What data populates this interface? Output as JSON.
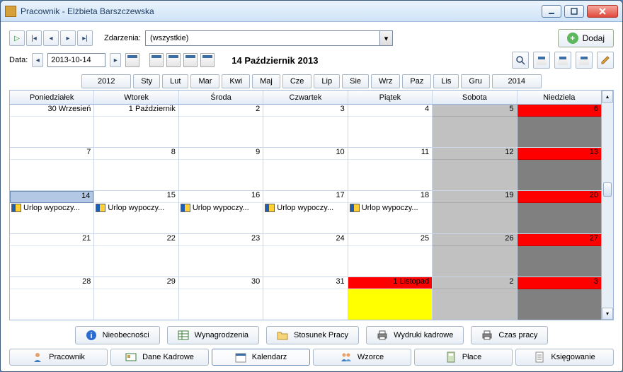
{
  "window": {
    "title": "Pracownik - Elżbieta Barszczewska"
  },
  "toolbar1": {
    "events_label": "Zdarzenia:",
    "events_value": "(wszystkie)",
    "add_label": "Dodaj"
  },
  "toolbar2": {
    "date_label": "Data:",
    "date_value": "2013-10-14",
    "heading": "14 Październik 2013"
  },
  "monthnav": {
    "prev_year": "2012",
    "next_year": "2014",
    "months": [
      "Sty",
      "Lut",
      "Mar",
      "Kwi",
      "Maj",
      "Cze",
      "Lip",
      "Sie",
      "Wrz",
      "Paz",
      "Lis",
      "Gru"
    ]
  },
  "day_headers": [
    "Poniedziałek",
    "Wtorek",
    "Środa",
    "Czwartek",
    "Piątek",
    "Sobota",
    "Niedziela"
  ],
  "event_text": "Urlop wypoczy...",
  "weeks": [
    [
      {
        "label": "30 Wrzesień"
      },
      {
        "label": "1 Październik"
      },
      {
        "label": "2"
      },
      {
        "label": "3"
      },
      {
        "label": "4"
      },
      {
        "label": "5",
        "sat": true
      },
      {
        "label": "6",
        "sun": true
      }
    ],
    [
      {
        "label": "7"
      },
      {
        "label": "8"
      },
      {
        "label": "9"
      },
      {
        "label": "10"
      },
      {
        "label": "11"
      },
      {
        "label": "12",
        "sat": true
      },
      {
        "label": "13",
        "sun": true
      }
    ],
    [
      {
        "label": "14",
        "selected": true,
        "event": true
      },
      {
        "label": "15",
        "event": true
      },
      {
        "label": "16",
        "event": true
      },
      {
        "label": "17",
        "event": true
      },
      {
        "label": "18",
        "event": true
      },
      {
        "label": "19",
        "sat": true
      },
      {
        "label": "20",
        "sun": true
      }
    ],
    [
      {
        "label": "21"
      },
      {
        "label": "22"
      },
      {
        "label": "23"
      },
      {
        "label": "24"
      },
      {
        "label": "25"
      },
      {
        "label": "26",
        "sat": true
      },
      {
        "label": "27",
        "sun": true
      }
    ],
    [
      {
        "label": "28"
      },
      {
        "label": "29"
      },
      {
        "label": "30"
      },
      {
        "label": "31"
      },
      {
        "label": "1 Listopad",
        "holiday": true
      },
      {
        "label": "2",
        "sat": true
      },
      {
        "label": "3",
        "sun": true
      }
    ]
  ],
  "action_buttons": [
    {
      "label": "Nieobecności",
      "icon": "info"
    },
    {
      "label": "Wynagrodzenia",
      "icon": "table"
    },
    {
      "label": "Stosunek Pracy",
      "icon": "folder"
    },
    {
      "label": "Wydruki kadrowe",
      "icon": "printer"
    },
    {
      "label": "Czas pracy",
      "icon": "printer"
    }
  ],
  "tabs": [
    {
      "label": "Pracownik",
      "icon": "person"
    },
    {
      "label": "Dane Kadrowe",
      "icon": "card"
    },
    {
      "label": "Kalendarz",
      "icon": "calendar",
      "active": true
    },
    {
      "label": "Wzorce",
      "icon": "people"
    },
    {
      "label": "Płace",
      "icon": "calc"
    },
    {
      "label": "Księgowanie",
      "icon": "doc"
    }
  ]
}
